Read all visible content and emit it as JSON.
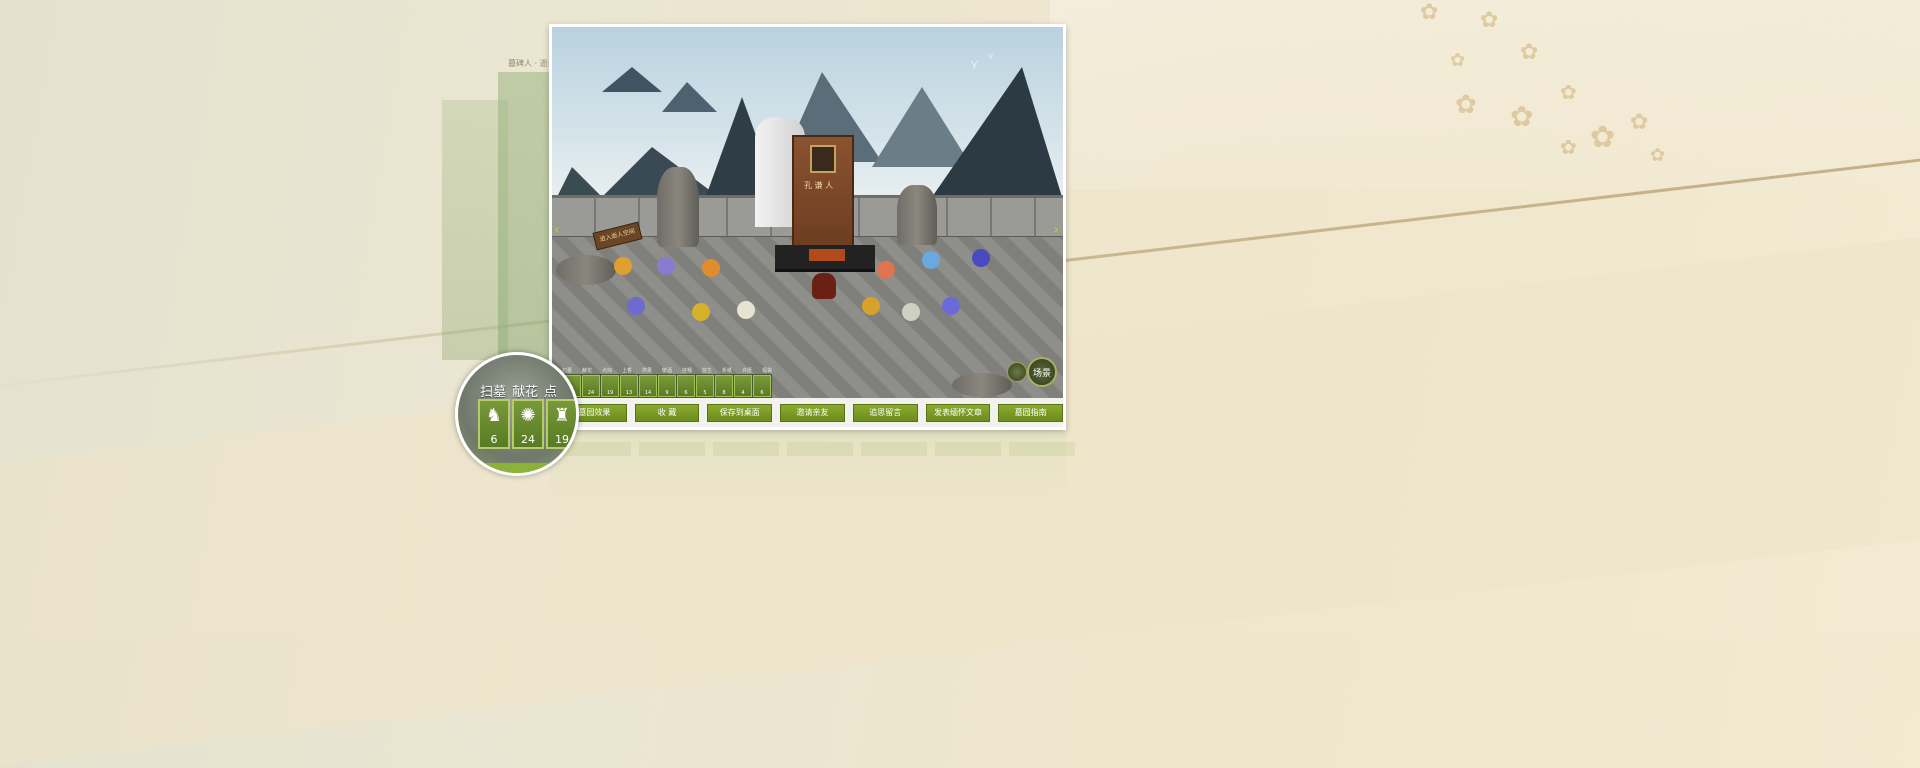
{
  "scene": {
    "tomb_name": "孔 谦 人",
    "sign_text": "进入逝人空间",
    "scene_button_label": "场景",
    "prev_arrow": "‹",
    "next_arrow": "›"
  },
  "toolbar": {
    "labels": [
      "扫墓",
      "献花",
      "点烛",
      "上香",
      "供果",
      "敬酒",
      "挂幡",
      "放生",
      "折纸",
      "许愿",
      "福袋",
      "放灯",
      "写信"
    ],
    "counts": [
      "6",
      "24",
      "19",
      "13",
      "14",
      "9",
      "6",
      "5",
      "8",
      "4",
      "6",
      "",
      ""
    ]
  },
  "buttons": [
    {
      "label": "墓园效果"
    },
    {
      "label": "收 藏"
    },
    {
      "label": "保存到桌面"
    },
    {
      "label": "邀请亲友"
    },
    {
      "label": "追思留言"
    },
    {
      "label": "发表缅怀文章"
    },
    {
      "label": "墓园指南"
    }
  ],
  "magnifier": {
    "labels": [
      "扫墓",
      "献花",
      "点"
    ],
    "tools": [
      {
        "icon": "broom-icon",
        "glyph": "♞",
        "count": "6"
      },
      {
        "icon": "flower-icon",
        "glyph": "✺",
        "count": "24"
      },
      {
        "icon": "candle-icon",
        "glyph": "♜",
        "count": "19"
      }
    ]
  },
  "ghost_label": "墓碑人 · 逝去者"
}
